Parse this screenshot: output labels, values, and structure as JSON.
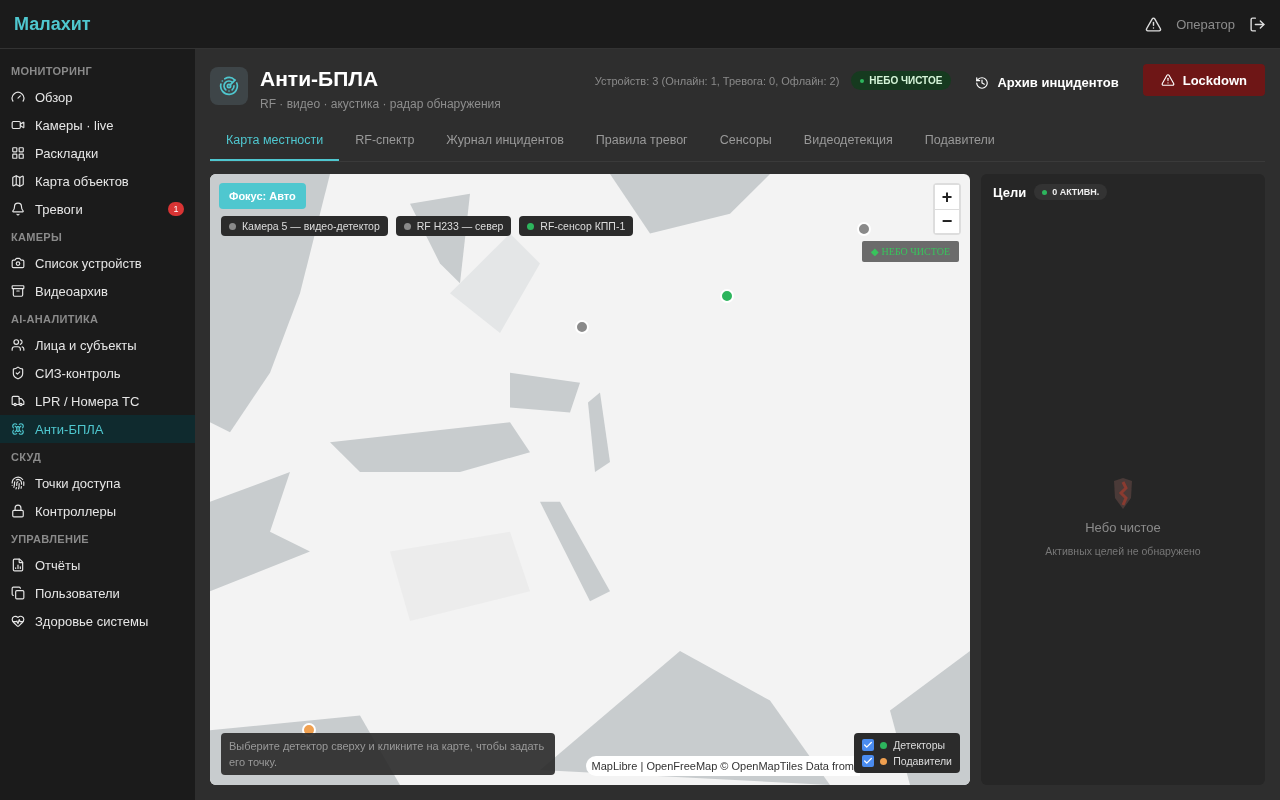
{
  "topbar": {
    "logo": "Малахит",
    "user": "Оператор"
  },
  "sidebar": {
    "sections": [
      {
        "title": "МОНИТОРИНГ",
        "items": [
          {
            "label": "Обзор",
            "selected": false
          },
          {
            "label": "Камеры · live",
            "selected": false
          },
          {
            "label": "Раскладки",
            "selected": false
          },
          {
            "label": "Карта объектов",
            "selected": false
          },
          {
            "label": "Тревоги",
            "selected": false,
            "badge": "1"
          }
        ]
      },
      {
        "title": "КАМЕРЫ",
        "items": [
          {
            "label": "Список устройств",
            "selected": false
          },
          {
            "label": "Видеоархив",
            "selected": false
          }
        ]
      },
      {
        "title": "AI-АНАЛИТИКА",
        "items": [
          {
            "label": "Лица и субъекты",
            "selected": false
          },
          {
            "label": "СИЗ-контроль",
            "selected": false
          },
          {
            "label": "LPR / Номера ТС",
            "selected": false
          },
          {
            "label": "Анти-БПЛА",
            "selected": true
          }
        ]
      },
      {
        "title": "СКУД",
        "items": [
          {
            "label": "Точки доступа",
            "selected": false
          },
          {
            "label": "Контроллеры",
            "selected": false
          }
        ]
      },
      {
        "title": "УПРАВЛЕНИЕ",
        "items": [
          {
            "label": "Отчёты",
            "selected": false
          },
          {
            "label": "Пользователи",
            "selected": false
          },
          {
            "label": "Здоровье системы",
            "selected": false
          }
        ]
      }
    ]
  },
  "header": {
    "title": "Анти-БПЛА",
    "subtitle": "RF · видео · акустика · радар обнаружения",
    "devices": "Устройств: 3 (Онлайн: 1, Тревога: 0, Офлайн: 2)",
    "status": "НЕБО ЧИСТОЕ",
    "archive_button": "Архив инцидентов",
    "lockdown_button": "Lockdown"
  },
  "tabs": [
    {
      "label": "Карта местности",
      "selected": true
    },
    {
      "label": "RF-спектр",
      "selected": false
    },
    {
      "label": "Журнал инцидентов",
      "selected": false
    },
    {
      "label": "Правила тревог",
      "selected": false
    },
    {
      "label": "Сенсоры",
      "selected": false
    },
    {
      "label": "Видеодетекция",
      "selected": false
    },
    {
      "label": "Подавители",
      "selected": false
    }
  ],
  "map": {
    "focus_button": "Фокус: Авто",
    "detectors": [
      {
        "label": "Камера 5 — видео-детектор",
        "color": "#8a8a8a"
      },
      {
        "label": "RF H233 — север",
        "color": "#8a8a8a"
      },
      {
        "label": "RF-сенсор КПП-1",
        "color": "#2db55d"
      }
    ],
    "markers": [
      {
        "color": "#8a8a8a"
      },
      {
        "color": "#2db55d"
      },
      {
        "color": "#8a8a8a"
      },
      {
        "color": "#f0a050"
      }
    ],
    "zoom_in": "+",
    "zoom_out": "−",
    "sky_badge": "◆ НЕБО ЧИСТОЕ",
    "hint": "Выберите детектор сверху и кликните на карте, чтобы задать его точку.",
    "attribution": "MapLibre | OpenFreeMap © OpenMapTiles Data from",
    "legend": [
      {
        "label": "Детекторы",
        "checked": true,
        "color": "#2db55d"
      },
      {
        "label": "Подавители",
        "checked": true,
        "color": "#f0a050"
      }
    ]
  },
  "targets": {
    "title": "Цели",
    "count": "0 АКТИВН.",
    "empty_title": "Небо чистое",
    "empty_text": "Активных целей не обнаружено"
  }
}
